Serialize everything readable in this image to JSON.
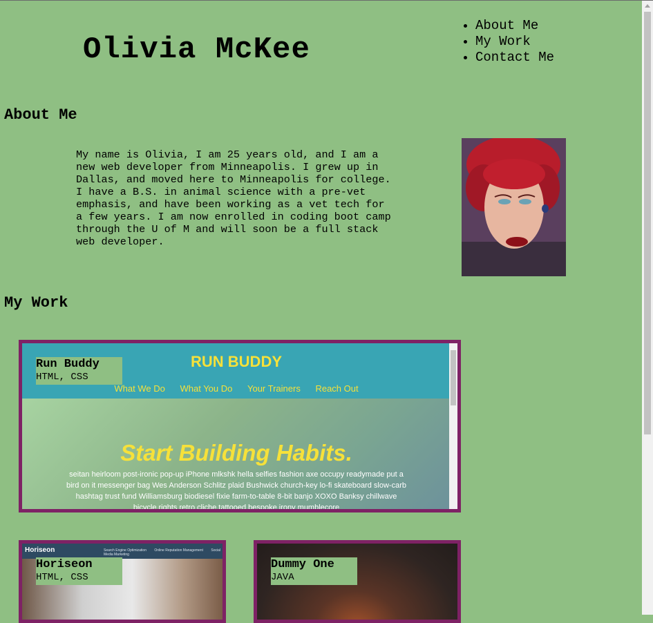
{
  "header": {
    "title": "Olivia McKee",
    "nav": [
      "About Me",
      "My Work",
      "Contact Me"
    ]
  },
  "about": {
    "heading": "About Me",
    "text": "My name is Olivia, I am 25 years old, and I am a new web developer from Minneapolis. I grew up in Dallas, and moved here to Minneapolis for college. I have a B.S. in animal science with a pre-vet emphasis, and have been working as a vet tech for a few years. I am now enrolled in coding boot camp through the U of M and will soon be a full stack web developer."
  },
  "work": {
    "heading": "My Work",
    "projects": [
      {
        "title": "Run Buddy",
        "tech": "HTML, CSS",
        "preview": {
          "brand": "RUN BUDDY",
          "nav": [
            "What We Do",
            "What You Do",
            "Your Trainers",
            "Reach Out"
          ],
          "hero_title": "Start Building Habits.",
          "hero_copy": "seitan heirloom post-ironic pop-up iPhone mlkshk hella selfies fashion axe occupy readymade put a bird on it messenger bag Wes Anderson Schlitz plaid Bushwick church-key lo-fi skateboard slow-carb hashtag trust fund Williamsburg biodiesel fixie farm-to-table 8-bit banjo XOXO Banksy chillwave bicycle rights retro cliche tattooed bespoke irony mumblecore"
        }
      },
      {
        "title": "Horiseon",
        "tech": "HTML, CSS",
        "preview": {
          "brand": "Horiseon",
          "links": [
            "Search Engine Optimization",
            "Online Reputation Management",
            "Social Media Marketing"
          ]
        }
      },
      {
        "title": "Dummy One",
        "tech": "JAVA"
      }
    ]
  },
  "colors": {
    "background": "#8fbf83",
    "card_border": "#7e2265",
    "run_buddy_teal": "#39a5b4",
    "run_buddy_yellow": "#f6e13a"
  }
}
